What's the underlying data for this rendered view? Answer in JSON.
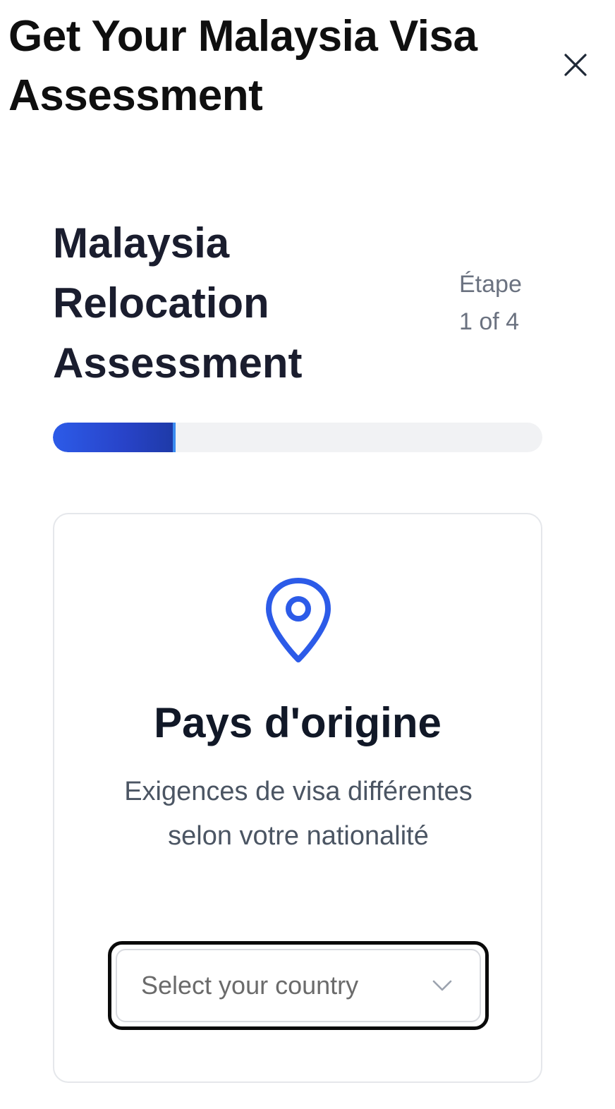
{
  "modal": {
    "title": "Get Your Malaysia Visa Assessment",
    "close_icon": "close-icon"
  },
  "assessment": {
    "title": "Malaysia Relocation Assessment",
    "step_label": "Étape",
    "step_count": "1 of 4",
    "progress": 0.25,
    "accent_color": "#2c5be8"
  },
  "question": {
    "icon": "map-pin-icon",
    "title": "Pays d'origine",
    "description": "Exigences de visa différentes selon votre nationalité",
    "select": {
      "placeholder": "Select your country",
      "icon": "chevron-down-icon"
    }
  }
}
